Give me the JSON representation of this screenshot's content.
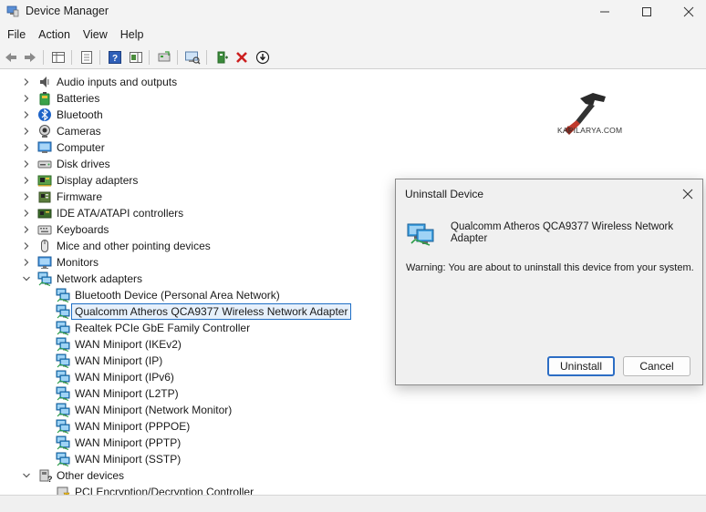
{
  "window": {
    "title": "Device Manager"
  },
  "menu": [
    "File",
    "Action",
    "View",
    "Help"
  ],
  "tree": [
    {
      "label": "Audio inputs and outputs",
      "icon": "speaker-icon",
      "level": 0,
      "state": "collapsed"
    },
    {
      "label": "Batteries",
      "icon": "battery-icon",
      "level": 0,
      "state": "collapsed"
    },
    {
      "label": "Bluetooth",
      "icon": "bluetooth-icon",
      "level": 0,
      "state": "collapsed"
    },
    {
      "label": "Cameras",
      "icon": "camera-icon",
      "level": 0,
      "state": "collapsed"
    },
    {
      "label": "Computer",
      "icon": "computer-icon",
      "level": 0,
      "state": "collapsed"
    },
    {
      "label": "Disk drives",
      "icon": "disk-drive-icon",
      "level": 0,
      "state": "collapsed"
    },
    {
      "label": "Display adapters",
      "icon": "display-adapter-icon",
      "level": 0,
      "state": "collapsed"
    },
    {
      "label": "Firmware",
      "icon": "firmware-icon",
      "level": 0,
      "state": "collapsed"
    },
    {
      "label": "IDE ATA/ATAPI controllers",
      "icon": "ide-controller-icon",
      "level": 0,
      "state": "collapsed"
    },
    {
      "label": "Keyboards",
      "icon": "keyboard-icon",
      "level": 0,
      "state": "collapsed"
    },
    {
      "label": "Mice and other pointing devices",
      "icon": "mouse-icon",
      "level": 0,
      "state": "collapsed"
    },
    {
      "label": "Monitors",
      "icon": "monitor-icon",
      "level": 0,
      "state": "collapsed"
    },
    {
      "label": "Network adapters",
      "icon": "network-adapter-icon",
      "level": 0,
      "state": "expanded"
    },
    {
      "label": "Bluetooth Device (Personal Area Network)",
      "icon": "network-adapter-icon",
      "level": 1
    },
    {
      "label": "Qualcomm Atheros QCA9377 Wireless Network Adapter",
      "icon": "network-adapter-icon",
      "level": 1,
      "selected": true
    },
    {
      "label": "Realtek PCIe GbE Family Controller",
      "icon": "network-adapter-icon",
      "level": 1
    },
    {
      "label": "WAN Miniport (IKEv2)",
      "icon": "network-adapter-icon",
      "level": 1
    },
    {
      "label": "WAN Miniport (IP)",
      "icon": "network-adapter-icon",
      "level": 1
    },
    {
      "label": "WAN Miniport (IPv6)",
      "icon": "network-adapter-icon",
      "level": 1
    },
    {
      "label": "WAN Miniport (L2TP)",
      "icon": "network-adapter-icon",
      "level": 1
    },
    {
      "label": "WAN Miniport (Network Monitor)",
      "icon": "network-adapter-icon",
      "level": 1
    },
    {
      "label": "WAN Miniport (PPPOE)",
      "icon": "network-adapter-icon",
      "level": 1
    },
    {
      "label": "WAN Miniport (PPTP)",
      "icon": "network-adapter-icon",
      "level": 1
    },
    {
      "label": "WAN Miniport (SSTP)",
      "icon": "network-adapter-icon",
      "level": 1
    },
    {
      "label": "Other devices",
      "icon": "other-devices-icon",
      "level": 0,
      "state": "expanded"
    },
    {
      "label": "PCI Encryption/Decryption Controller",
      "icon": "unknown-device-icon",
      "level": 1
    }
  ],
  "watermark": {
    "text": "KAPILARYA.COM"
  },
  "dialog": {
    "title": "Uninstall Device",
    "device_name": "Qualcomm Atheros QCA9377 Wireless Network Adapter",
    "warning": "Warning: You are about to uninstall this device from your system.",
    "uninstall_label": "Uninstall",
    "cancel_label": "Cancel"
  },
  "colors": {
    "accent": "#1f6fc5",
    "selected_bg": "#e6f0fb",
    "uninstall_red": "#cc1f1f"
  }
}
